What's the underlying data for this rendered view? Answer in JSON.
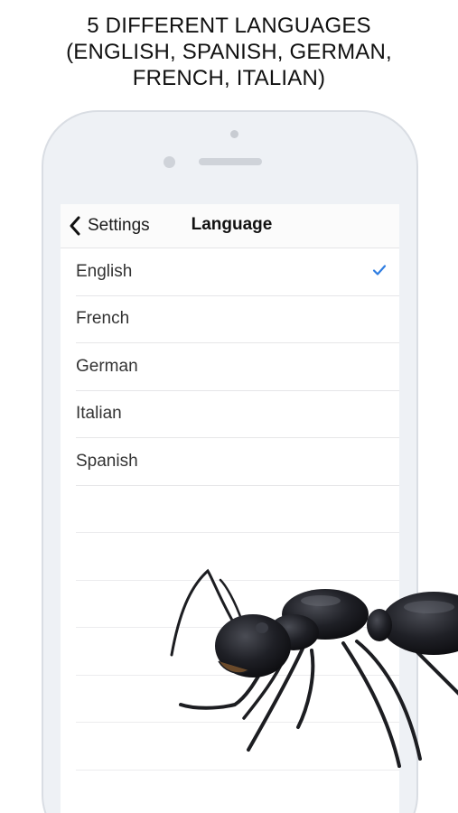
{
  "headline": {
    "lines": [
      "5 DIFFERENT LANGUAGES",
      "(ENGLISH, SPANISH, GERMAN,",
      "FRENCH, ITALIAN)"
    ]
  },
  "navbar": {
    "back_label": "Settings",
    "title": "Language",
    "back_icon": "chevron-left-icon"
  },
  "languages": [
    {
      "label": "English",
      "selected": true
    },
    {
      "label": "French",
      "selected": false
    },
    {
      "label": "German",
      "selected": false
    },
    {
      "label": "Italian",
      "selected": false
    },
    {
      "label": "Spanish",
      "selected": false
    }
  ],
  "colors": {
    "accent": "#2f7de1",
    "phone_body": "#eef1f5",
    "ant": "#1c1d21"
  },
  "decoration": {
    "icon": "ant-illustration"
  }
}
